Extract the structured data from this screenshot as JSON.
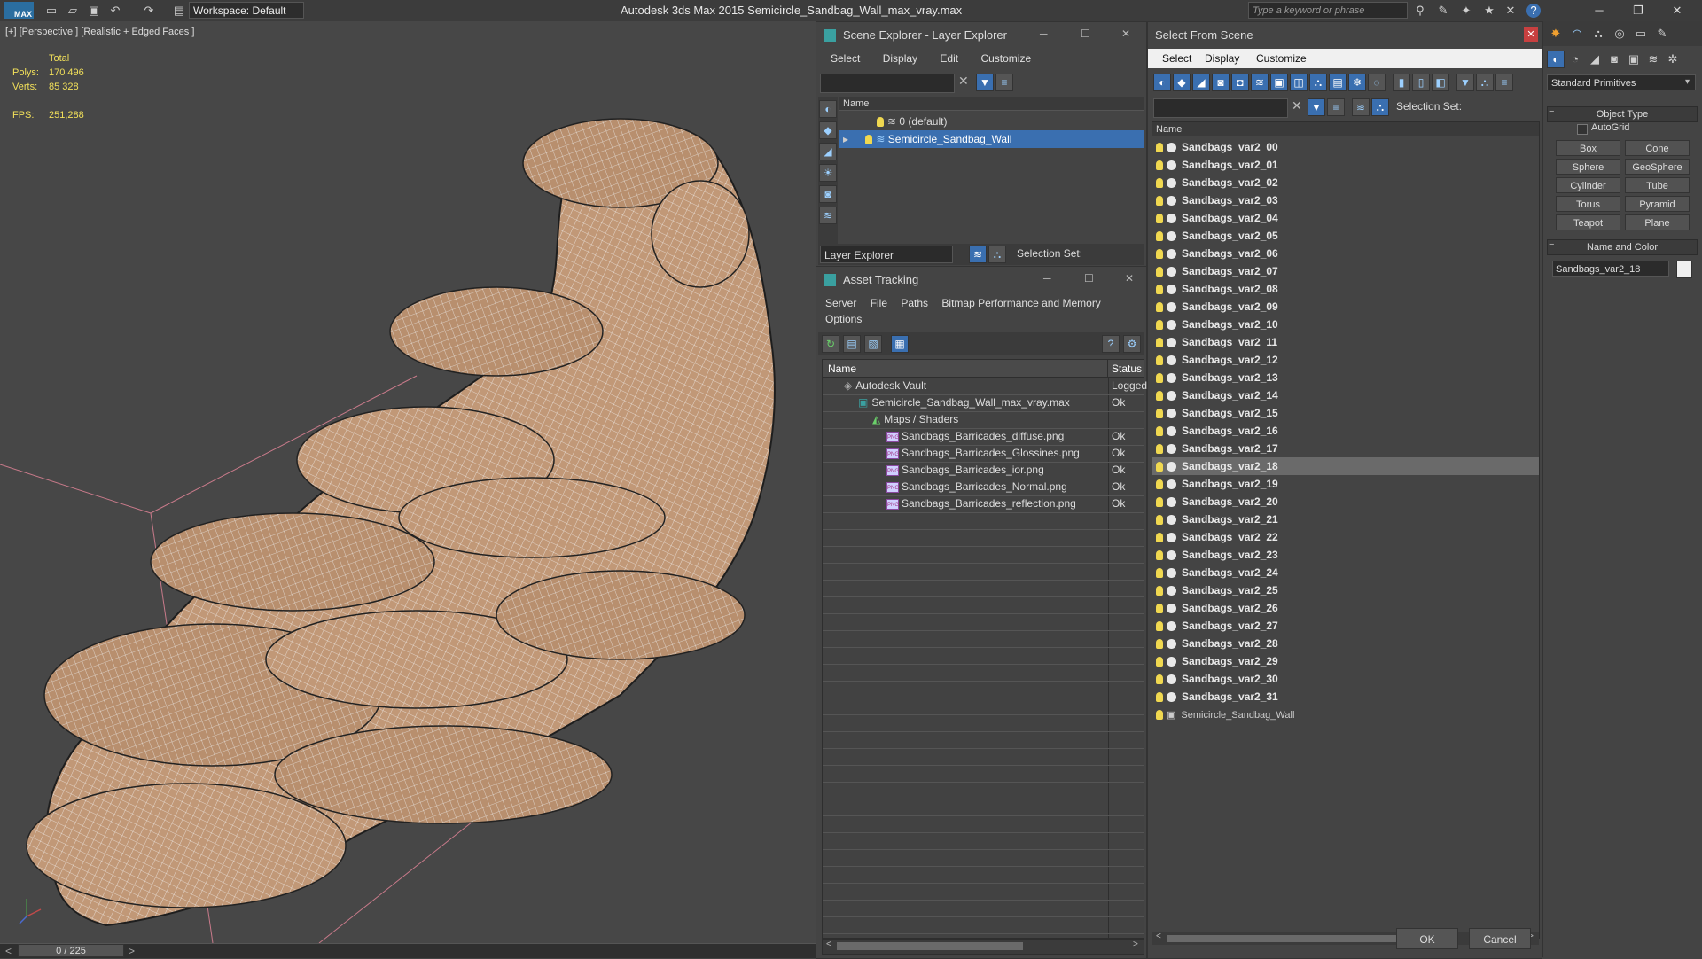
{
  "titlebar": {
    "logo": "MAX",
    "workspace": "Workspace: Default",
    "app_title": "Autodesk 3ds Max  2015     Semicircle_Sandbag_Wall_max_vray.max",
    "search_placeholder": "Type a keyword or phrase"
  },
  "viewport": {
    "label": "[+] [Perspective ] [Realistic + Edged Faces ]",
    "stats": {
      "total_label": "Total",
      "polys_label": "Polys:",
      "polys_value": "170 496",
      "verts_label": "Verts:",
      "verts_value": "85 328",
      "fps_label": "FPS:",
      "fps_value": "251,288"
    },
    "time_slider": "0 / 225"
  },
  "scene_explorer": {
    "title": "Scene Explorer - Layer Explorer",
    "menu": [
      "Select",
      "Display",
      "Edit",
      "Customize"
    ],
    "column_name": "Name",
    "layers": [
      {
        "label": "0 (default)",
        "selected": false
      },
      {
        "label": "Semicircle_Sandbag_Wall",
        "selected": true
      }
    ],
    "footer_dropdown": "Layer Explorer",
    "selection_set_label": "Selection Set:"
  },
  "asset_tracking": {
    "title": "Asset Tracking",
    "menu": [
      "Server",
      "File",
      "Paths",
      "Bitmap Performance and Memory"
    ],
    "menu2": "Options",
    "columns": [
      "Name",
      "Status"
    ],
    "rows": [
      {
        "name": "Autodesk Vault",
        "status": "Logged",
        "indent": 1
      },
      {
        "name": "Semicircle_Sandbag_Wall_max_vray.max",
        "status": "Ok",
        "indent": 2
      },
      {
        "name": "Maps / Shaders",
        "status": "",
        "indent": 3
      },
      {
        "name": "Sandbags_Barricades_diffuse.png",
        "status": "Ok",
        "indent": 4
      },
      {
        "name": "Sandbags_Barricades_Glossines.png",
        "status": "Ok",
        "indent": 4
      },
      {
        "name": "Sandbags_Barricades_ior.png",
        "status": "Ok",
        "indent": 4
      },
      {
        "name": "Sandbags_Barricades_Normal.png",
        "status": "Ok",
        "indent": 4
      },
      {
        "name": "Sandbags_Barricades_reflection.png",
        "status": "Ok",
        "indent": 4
      }
    ]
  },
  "select_from_scene": {
    "title": "Select From Scene",
    "menu": [
      "Select",
      "Display",
      "Customize"
    ],
    "selection_set_label": "Selection Set:",
    "column_name": "Name",
    "items": [
      "Sandbags_var2_00",
      "Sandbags_var2_01",
      "Sandbags_var2_02",
      "Sandbags_var2_03",
      "Sandbags_var2_04",
      "Sandbags_var2_05",
      "Sandbags_var2_06",
      "Sandbags_var2_07",
      "Sandbags_var2_08",
      "Sandbags_var2_09",
      "Sandbags_var2_10",
      "Sandbags_var2_11",
      "Sandbags_var2_12",
      "Sandbags_var2_13",
      "Sandbags_var2_14",
      "Sandbags_var2_15",
      "Sandbags_var2_16",
      "Sandbags_var2_17",
      "Sandbags_var2_18",
      "Sandbags_var2_19",
      "Sandbags_var2_20",
      "Sandbags_var2_21",
      "Sandbags_var2_22",
      "Sandbags_var2_23",
      "Sandbags_var2_24",
      "Sandbags_var2_25",
      "Sandbags_var2_26",
      "Sandbags_var2_27",
      "Sandbags_var2_28",
      "Sandbags_var2_29",
      "Sandbags_var2_30",
      "Sandbags_var2_31"
    ],
    "selected_item": "Sandbags_var2_18",
    "group_item": "Semicircle_Sandbag_Wall",
    "ok_label": "OK",
    "cancel_label": "Cancel"
  },
  "command_panel": {
    "dropdown": "Standard Primitives",
    "object_type_header": "Object Type",
    "autogrid_label": "AutoGrid",
    "buttons": [
      "Box",
      "Cone",
      "Sphere",
      "GeoSphere",
      "Cylinder",
      "Tube",
      "Torus",
      "Pyramid",
      "Teapot",
      "Plane"
    ],
    "name_color_header": "Name and Color",
    "name_value": "Sandbags_var2_18"
  },
  "colors": {
    "accent": "#3a6fb0",
    "stats_text": "#f2e05a",
    "mesh": "#c19877"
  }
}
